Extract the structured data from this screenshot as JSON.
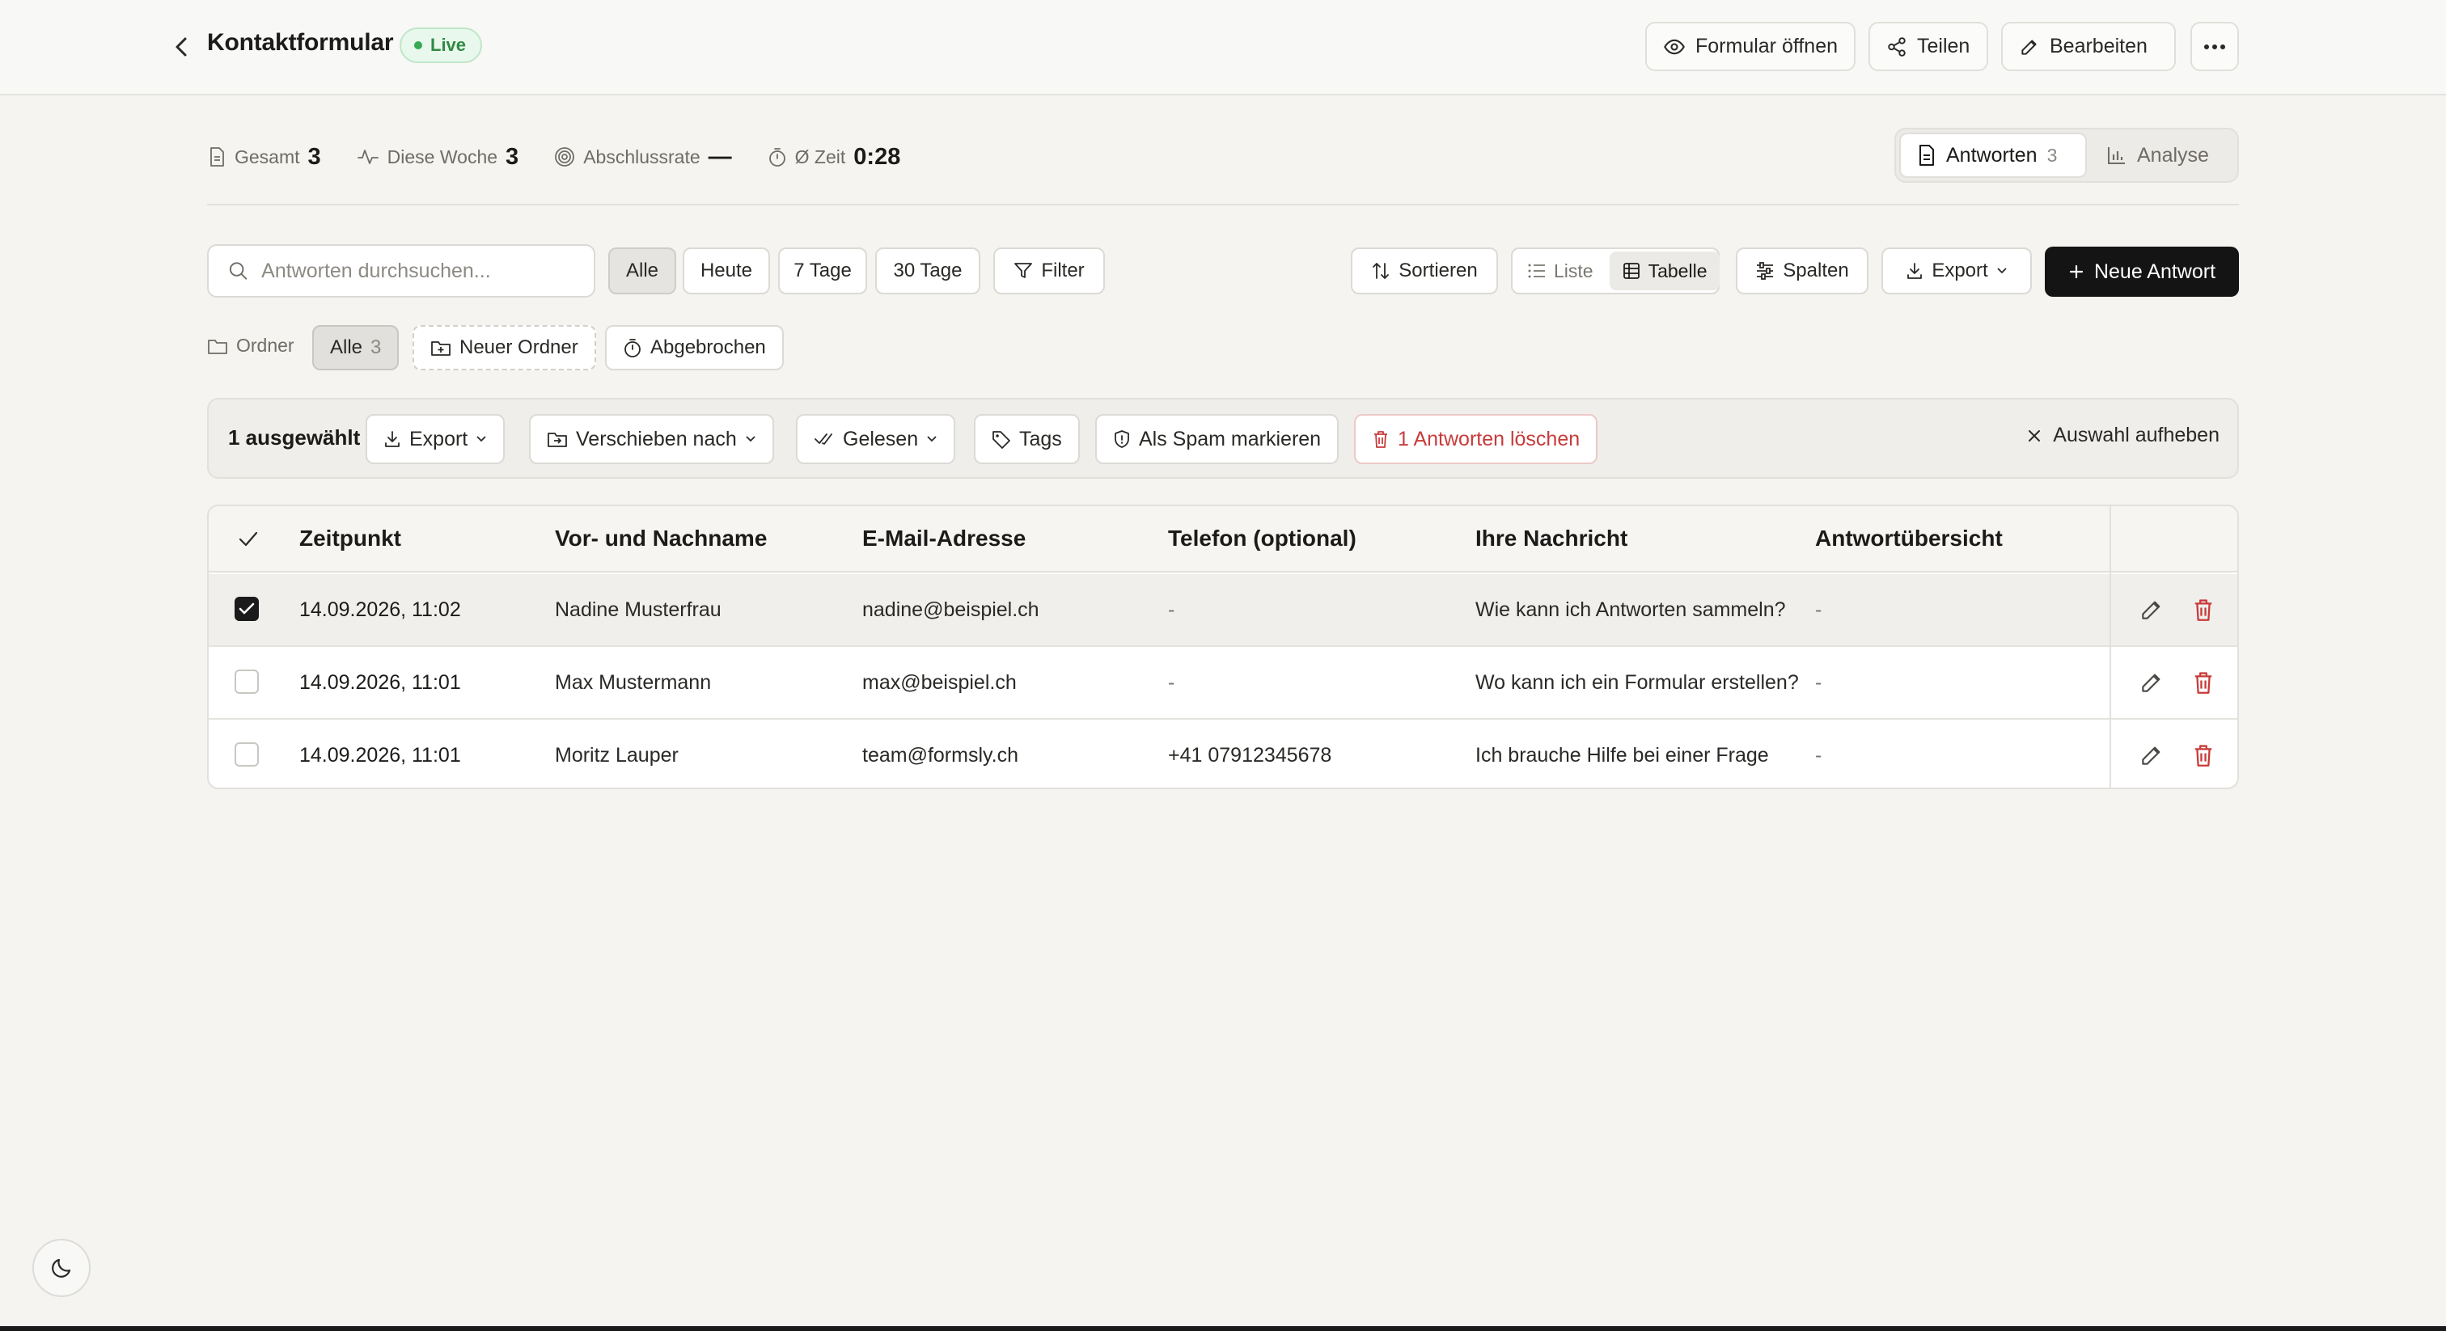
{
  "header": {
    "title": "Kontaktformular",
    "status": "Live",
    "open_form": "Formular öffnen",
    "share": "Teilen",
    "edit": "Bearbeiten"
  },
  "stats": {
    "total_label": "Gesamt",
    "total_value": "3",
    "week_label": "Diese Woche",
    "week_value": "3",
    "completion_label": "Abschlussrate",
    "completion_value": "—",
    "time_label": "Ø Zeit",
    "time_value": "0:28"
  },
  "view": {
    "responses_label": "Antworten",
    "responses_count": "3",
    "analysis_label": "Analyse"
  },
  "toolbar": {
    "search_placeholder": "Antworten durchsuchen...",
    "range_all": "Alle",
    "range_today": "Heute",
    "range_7": "7 Tage",
    "range_30": "30 Tage",
    "filter": "Filter",
    "sort": "Sortieren",
    "mode_list": "Liste",
    "mode_table": "Tabelle",
    "columns": "Spalten",
    "export": "Export",
    "new_response": "Neue Antwort"
  },
  "folders": {
    "label": "Ordner",
    "all_label": "Alle",
    "all_count": "3",
    "new_folder": "Neuer Ordner",
    "aborted": "Abgebrochen"
  },
  "selection": {
    "count": "1 ausgewählt",
    "export": "Export",
    "move": "Verschieben nach",
    "read": "Gelesen",
    "tags": "Tags",
    "spam": "Als Spam markieren",
    "delete": "1 Antworten löschen",
    "clear": "Auswahl aufheben"
  },
  "table": {
    "columns": [
      "Zeitpunkt",
      "Vor- und Nachname",
      "E-Mail-Adresse",
      "Telefon (optional)",
      "Ihre Nachricht",
      "Antwortübersicht"
    ],
    "rows": [
      {
        "selected": true,
        "time": "14.09.2026, 11:02",
        "name": "Nadine Musterfrau",
        "email": "nadine@beispiel.ch",
        "phone": "-",
        "message": "Wie kann ich Antworten sammeln?",
        "summary": "-"
      },
      {
        "selected": false,
        "time": "14.09.2026, 11:01",
        "name": "Max Mustermann",
        "email": "max@beispiel.ch",
        "phone": "-",
        "message": "Wo kann ich ein Formular erstellen?",
        "summary": "-"
      },
      {
        "selected": false,
        "time": "14.09.2026, 11:01",
        "name": "Moritz Lauper",
        "email": "team@formsly.ch",
        "phone": "+41 07912345678",
        "message": "Ich brauche Hilfe bei einer Frage",
        "summary": "-"
      }
    ]
  },
  "colors": {
    "accent": "#141414",
    "live_green": "#35a953",
    "danger": "#c83a3a",
    "background": "#f5f4f1"
  }
}
